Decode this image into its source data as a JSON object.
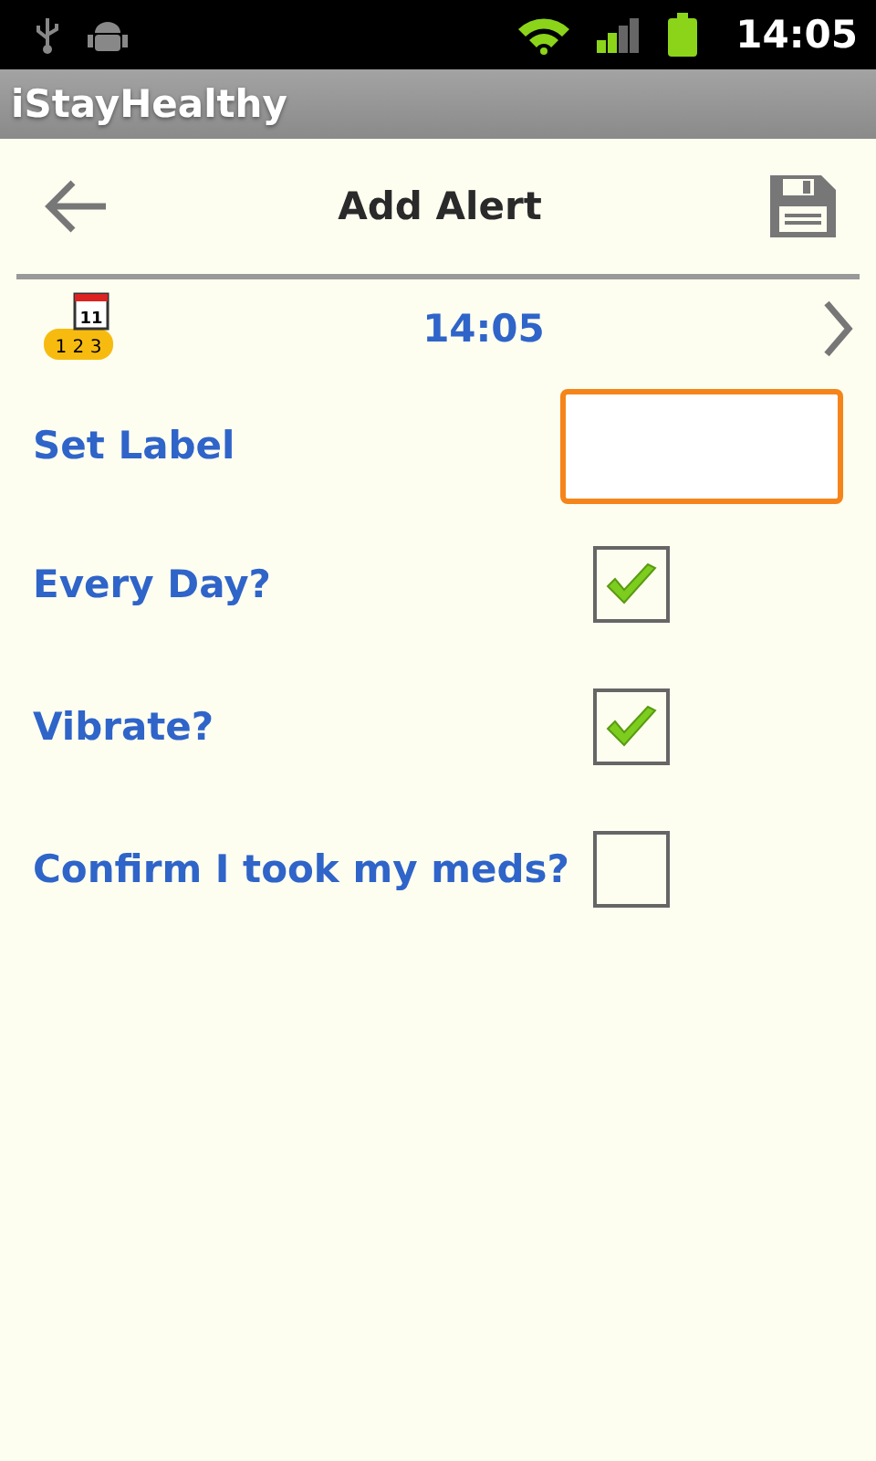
{
  "status_bar": {
    "time": "14:05"
  },
  "app_title": "iStayHealthy",
  "header": {
    "title": "Add Alert"
  },
  "time_row": {
    "calendar_day": "11",
    "badge_digits": "1 2 3",
    "time": "14:05"
  },
  "label_field": {
    "label": "Set Label",
    "focused": true
  },
  "options": [
    {
      "label": "Every Day?",
      "checked": true
    },
    {
      "label": "Vibrate?",
      "checked": true
    },
    {
      "label": "Confirm I took my meds?",
      "checked": false
    }
  ]
}
